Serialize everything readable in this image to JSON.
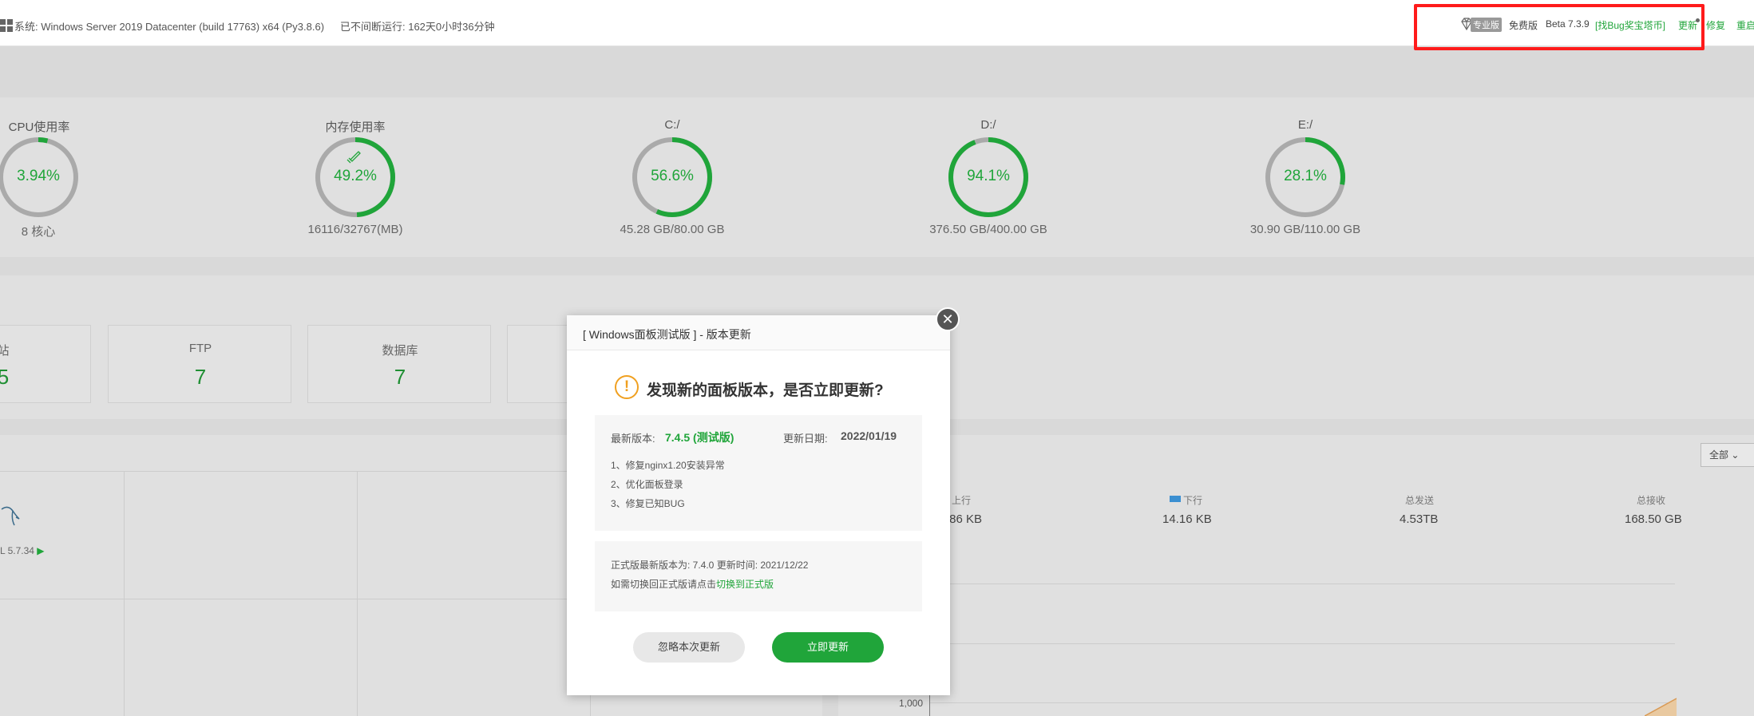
{
  "topbar": {
    "system_label": "系统:",
    "system_text": "Windows Server 2019 Datacenter (build 17763) x64 (Py3.8.6)",
    "uptime": "已不间断运行: 162天0小时36分钟",
    "pro_badge": "专业版",
    "free_label": "免费版",
    "version": "Beta 7.3.9",
    "bug_link": "[找Bug奖宝塔币]",
    "update_link": "更新",
    "fix_link": "修复",
    "restart_link": "重启"
  },
  "stats": [
    {
      "label": "CPU使用率",
      "value": "3.94%",
      "percent": 3.94,
      "sub": "8 核心"
    },
    {
      "label": "内存使用率",
      "value": "49.2%",
      "percent": 49.2,
      "sub": "16116/32767(MB)"
    },
    {
      "label": "C:/",
      "value": "56.6%",
      "percent": 56.6,
      "sub": "45.28 GB/80.00 GB"
    },
    {
      "label": "D:/",
      "value": "94.1%",
      "percent": 94.1,
      "sub": "376.50 GB/400.00 GB"
    },
    {
      "label": "E:/",
      "value": "28.1%",
      "percent": 28.1,
      "sub": "30.90 GB/110.00 GB"
    }
  ],
  "cards": [
    {
      "label": "站",
      "value": "5"
    },
    {
      "label": "FTP",
      "value": "7"
    },
    {
      "label": "数据库",
      "value": "7"
    }
  ],
  "software": {
    "mysql": "L 5.7.34"
  },
  "network": {
    "filter": "全部",
    "up_label": "上行",
    "up_value": ".86 KB",
    "down_label": "下行",
    "down_value": "14.16 KB",
    "total_sent_label": "总发送",
    "total_sent_value": "4.53TB",
    "total_recv_label": "总接收",
    "total_recv_value": "168.50 GB",
    "y_tick": "1,000"
  },
  "modal": {
    "title": "[ Windows面板测试版 ] - 版本更新",
    "headline": "发现新的面板版本，是否立即更新?",
    "latest_label": "最新版本:",
    "latest_value": "7.4.5 (测试版)",
    "date_label": "更新日期:",
    "date_value": "2022/01/19",
    "notes": [
      "1、修复nginx1.20安装异常",
      "2、优化面板登录",
      "3、修复已知BUG"
    ],
    "stable_text": "正式版最新版本为: 7.4.0   更新时间: 2021/12/22",
    "switch_prefix": "如需切换回正式版请点击",
    "switch_link": "切换到正式版",
    "ignore_button": "忽略本次更新",
    "update_button": "立即更新",
    "close_symbol": "✕"
  },
  "colors": {
    "accent": "#20a53a",
    "highlight": "#ff1b1b",
    "warning": "#f0a020"
  }
}
